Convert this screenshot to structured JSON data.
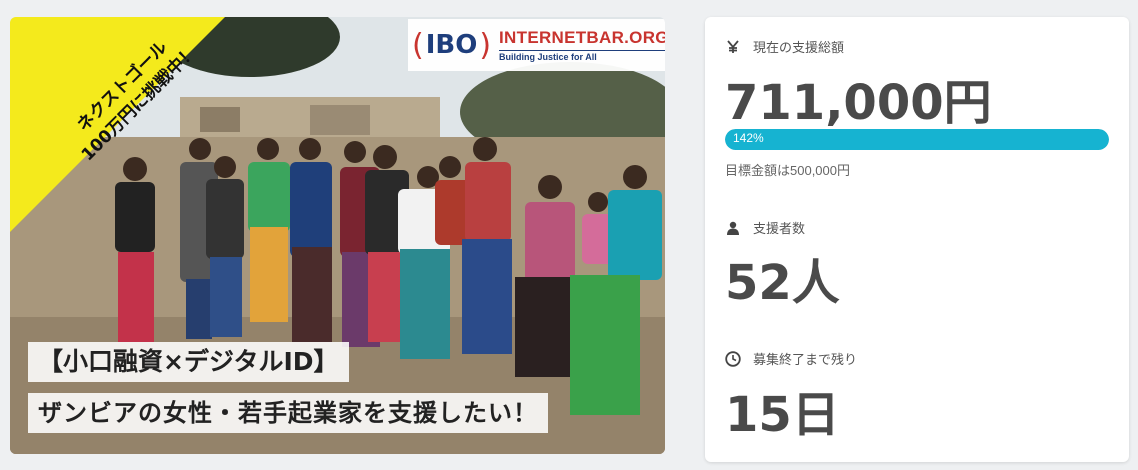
{
  "hero": {
    "corner_banner_lines": [
      "ネクストゴール",
      "100万円に挑戦中！"
    ],
    "logo": {
      "mark": "IBO",
      "title": "INTERNETBAR.ORG",
      "subtitle": "Building Justice for All"
    },
    "caption_line1": "【小口融資×デジタルID】",
    "caption_line2": "ザンビアの女性・若手起業家を支援したい！"
  },
  "stats": {
    "total": {
      "icon": "yen-icon",
      "label": "現在の支援総額",
      "value": "711,000円"
    },
    "progress": {
      "percent_label": "142%",
      "fill_fraction": 1.0,
      "color": "#16b3d1"
    },
    "target_note": "目標金額は500,000円",
    "supporters": {
      "icon": "person-icon",
      "label": "支援者数",
      "value": "52人"
    },
    "remaining": {
      "icon": "clock-icon",
      "label": "募集終了まで残り",
      "value": "15日"
    }
  }
}
